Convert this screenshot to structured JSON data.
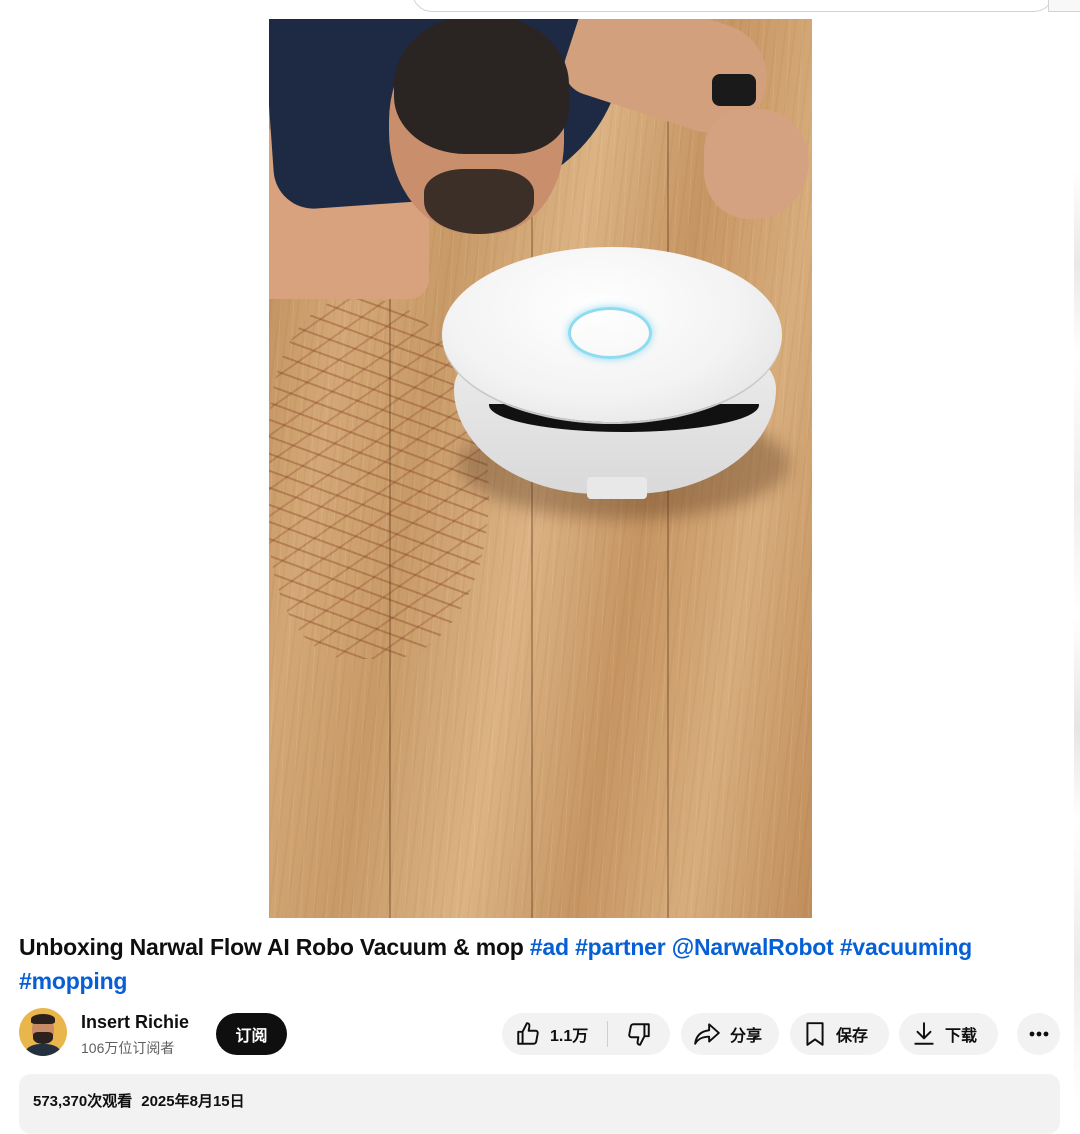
{
  "video": {
    "title_main": "Unboxing Narwal Flow AI Robo Vacuum & mop",
    "tags": [
      "#ad",
      "#partner",
      "@NarwalRobot",
      "#vacuuming",
      "#mopping"
    ]
  },
  "channel": {
    "name": "Insert Richie",
    "subscribers": "106万位订阅者",
    "subscribe_label": "订阅"
  },
  "actions": {
    "like_count": "1.1万",
    "share_label": "分享",
    "save_label": "保存",
    "download_label": "下载"
  },
  "description": {
    "views": "573,370次观看",
    "date": "2025年8月15日"
  },
  "icons": {
    "like": "thumbs-up-icon",
    "dislike": "thumbs-down-icon",
    "share": "share-arrow-icon",
    "save": "bookmark-icon",
    "download": "download-icon",
    "more": "more-horizontal-icon"
  },
  "colors": {
    "link": "#065fd4",
    "subscribe_bg": "#0f0f0f",
    "pill_bg": "#f2f2f2",
    "secondary_text": "#606060"
  }
}
